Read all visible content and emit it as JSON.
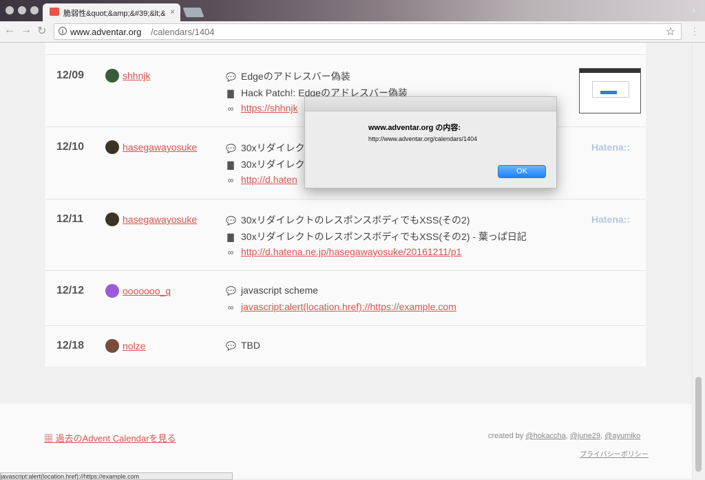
{
  "browser": {
    "tab_title": "脆弱性&quot;&amp;&#39;&lt;&l",
    "tab_close": "×",
    "url_host": "www.adventar.org",
    "url_path": "/calendars/1404",
    "back": "←",
    "forward": "→",
    "reload": "↻",
    "star": "☆",
    "menu": "⋮",
    "profile": "♁"
  },
  "rows": [
    {
      "date": "12/09",
      "user": "shhnjk",
      "avatar_color": "#3a5b3c",
      "comment": "Edgeのアドレスバー偽装",
      "title": "Hack Patch!: Edgeのアドレスバー偽装",
      "url": "https://shhnjk"
    },
    {
      "date": "12/10",
      "user": "hasegawayosuke",
      "avatar_color": "#3c3326",
      "comment": "30xリダイレク",
      "title": "30xリダイレク",
      "url": "http://d.haten",
      "badge": "Hatena::"
    },
    {
      "date": "12/11",
      "user": "hasegawayosuke",
      "avatar_color": "#3c3326",
      "comment": "30xリダイレクトのレスポンスボディでもXSS(その2)",
      "title": "30xリダイレクトのレスポンスボディでもXSS(その2) - 葉っぱ日記",
      "url": "http://d.hatena.ne.jp/hasegawayosuke/20161211/p1",
      "badge": "Hatena::"
    },
    {
      "date": "12/12",
      "user": "ooooooo_q",
      "avatar_color": "#9b5bd6",
      "comment": "javascript scheme",
      "url": "javascript:alert(location.href)://https://example.com"
    },
    {
      "date": "12/18",
      "user": "nolze",
      "avatar_color": "#7a4a3a",
      "comment": "TBD"
    }
  ],
  "footer": {
    "past_link": "過去のAdvent Calendarを見る",
    "created_by": "created by",
    "authors": [
      "@hokaccha",
      "@june29",
      "@ayumiko"
    ],
    "privacy": "プライバシーポリシー"
  },
  "dialog": {
    "title": "www.adventar.org の内容:",
    "message": "http://www.adventar.org/calendars/1404",
    "ok": "OK"
  },
  "status_bar": "javascript:alert(location.href)://https://example.com"
}
